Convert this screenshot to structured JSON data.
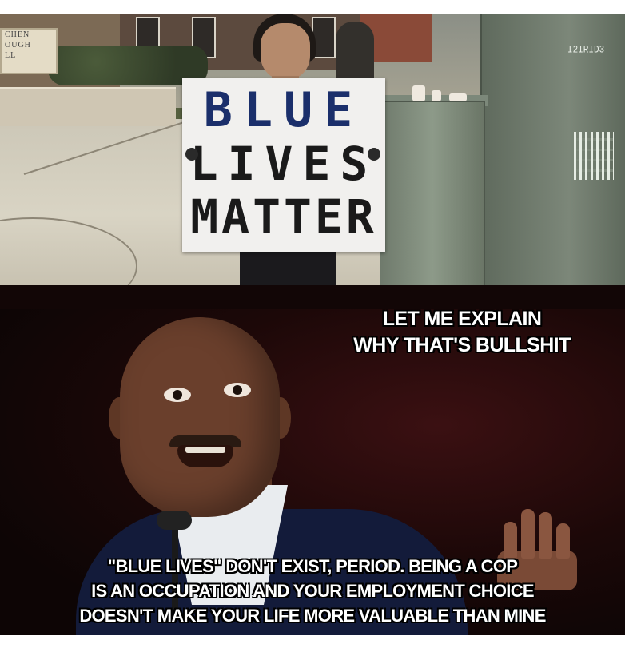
{
  "top_panel": {
    "background_sign_lines": [
      "CHEN",
      "OUGH",
      "LL"
    ],
    "cabinet_sticker": "I2IRID3",
    "protest_sign": {
      "line1": "BLUE",
      "line2": "LIVES",
      "line3": "MATTER"
    }
  },
  "bottom_panel": {
    "top_caption": [
      "LET ME EXPLAIN",
      "WHY THAT'S BULLSHIT"
    ],
    "bottom_caption": [
      "\"BLUE LIVES\" DON'T EXIST, PERIOD. BEING A COP",
      "IS AN OCCUPATION AND YOUR EMPLOYMENT CHOICE",
      "DOESN'T MAKE YOUR LIFE MORE VALUABLE THAN MINE"
    ]
  },
  "colors": {
    "sign_blue": "#1b2f6b",
    "caption_text": "#ffffff",
    "stage_background": "#1c0808"
  }
}
